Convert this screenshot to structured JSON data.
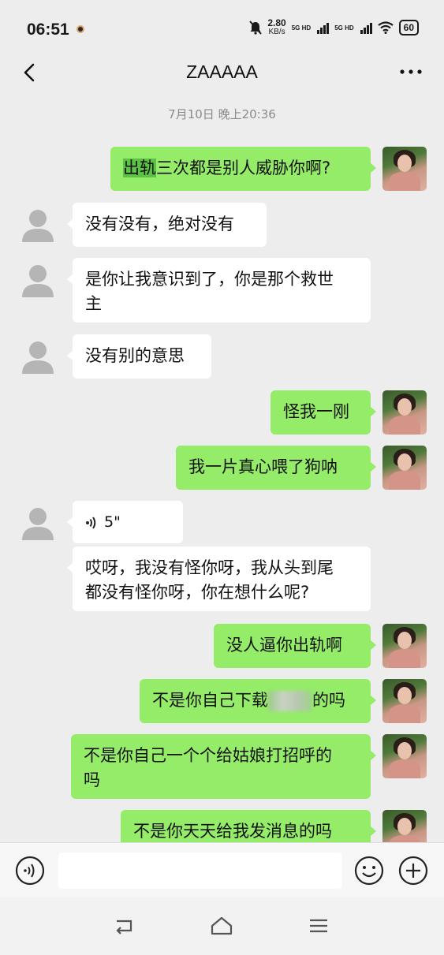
{
  "status_bar": {
    "time": "06:51",
    "net_speed_value": "2.80",
    "net_speed_unit": "KB/s",
    "net1": "5G HD",
    "net2": "5G HD",
    "battery": "60"
  },
  "header": {
    "title": "ZAAAAA",
    "back_icon": "chevron-left-icon",
    "more_icon": "more-dots-icon"
  },
  "chat": {
    "timestamp": "7月10日 晚上20:36",
    "messages": [
      {
        "side": "self",
        "text_hl": "出轨",
        "text": "三次都是别人威胁你啊?"
      },
      {
        "side": "other",
        "text": "没有没有，绝对没有"
      },
      {
        "side": "other",
        "line1": "是你让我意识到了，你是那个救世",
        "line2": "主"
      },
      {
        "side": "other",
        "text": "没有别的意思"
      },
      {
        "side": "self",
        "text": "怪我一刚"
      },
      {
        "side": "self",
        "text": "我一片真心喂了狗呐"
      },
      {
        "side": "other",
        "voice_duration": "5\""
      },
      {
        "side": "other",
        "line1": "哎呀，我没有怪你呀，我从头到尾",
        "line2": "都没有怪你呀，你在想什么呢?"
      },
      {
        "side": "self",
        "text": "没人逼你出轨啊"
      },
      {
        "side": "self",
        "text_before": "不是你自己下载",
        "text_after": "的吗"
      },
      {
        "side": "self",
        "line1": "不是你自己一个个给姑娘打招呼的",
        "line2": "吗"
      },
      {
        "side": "self",
        "text": "不是你天天给我发消息的吗"
      }
    ]
  },
  "input_bar": {
    "voice_icon": "voice-input-icon",
    "placeholder": "",
    "emoji_icon": "emoji-icon",
    "plus_icon": "plus-icon"
  },
  "nav_bar": {
    "back": "nav-back-icon",
    "home": "nav-home-icon",
    "menu": "nav-menu-icon"
  },
  "colors": {
    "background": "#ededed",
    "self_bubble": "#95ec69",
    "other_bubble": "#ffffff",
    "timestamp": "#8a8a8a"
  }
}
